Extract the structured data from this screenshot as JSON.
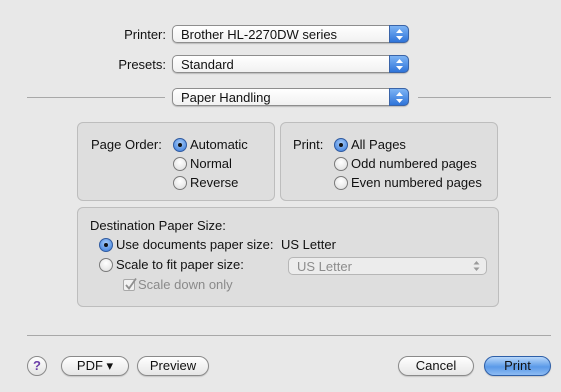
{
  "printer": {
    "label": "Printer:",
    "value": "Brother HL-2270DW series"
  },
  "presets": {
    "label": "Presets:",
    "value": "Standard"
  },
  "panel_selector": {
    "value": "Paper Handling"
  },
  "page_order": {
    "label": "Page Order:",
    "options": [
      {
        "label": "Automatic",
        "selected": true
      },
      {
        "label": "Normal",
        "selected": false
      },
      {
        "label": "Reverse",
        "selected": false
      }
    ]
  },
  "print_pages": {
    "label": "Print:",
    "options": [
      {
        "label": "All Pages",
        "selected": true
      },
      {
        "label": "Odd numbered pages",
        "selected": false
      },
      {
        "label": "Even numbered pages",
        "selected": false
      }
    ]
  },
  "destination": {
    "title": "Destination Paper Size:",
    "use_documents": {
      "label": "Use documents paper size:",
      "value": "US Letter",
      "selected": true
    },
    "scale_to_fit": {
      "label": "Scale to fit paper size:",
      "selected": false
    },
    "scale_popup_value": "US Letter",
    "scale_down_only": {
      "label": "Scale down only",
      "checked": true,
      "enabled": false
    }
  },
  "buttons": {
    "help": "?",
    "pdf": "PDF ▾",
    "preview": "Preview",
    "cancel": "Cancel",
    "print": "Print"
  }
}
